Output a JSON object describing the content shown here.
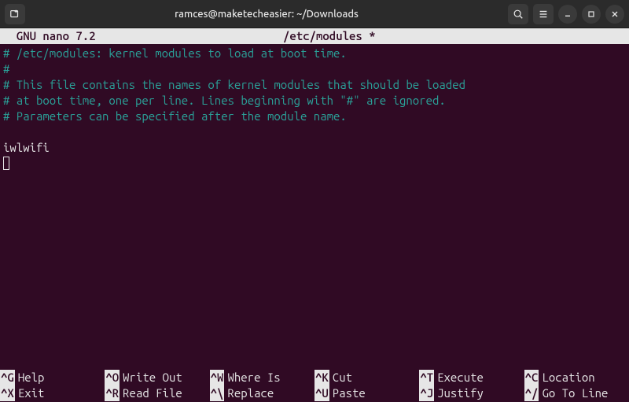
{
  "titlebar": {
    "title": "ramces@maketecheasier: ~/Downloads"
  },
  "nano": {
    "app": "  GNU nano 7.2",
    "file": "/etc/modules *"
  },
  "editor": {
    "l1": "# /etc/modules: kernel modules to load at boot time.",
    "l2": "#",
    "l3": "# This file contains the names of kernel modules that should be loaded",
    "l4": "# at boot time, one per line. Lines beginning with \"#\" are ignored.",
    "l5": "# Parameters can be specified after the module name.",
    "l6": "",
    "l7": "iwlwifi"
  },
  "shortcuts": {
    "row1": [
      {
        "k": "^G",
        "label": "Help"
      },
      {
        "k": "^O",
        "label": "Write Out"
      },
      {
        "k": "^W",
        "label": "Where Is"
      },
      {
        "k": "^K",
        "label": "Cut"
      },
      {
        "k": "^T",
        "label": "Execute"
      },
      {
        "k": "^C",
        "label": "Location"
      }
    ],
    "row2": [
      {
        "k": "^X",
        "label": "Exit"
      },
      {
        "k": "^R",
        "label": "Read File"
      },
      {
        "k": "^\\",
        "label": "Replace"
      },
      {
        "k": "^U",
        "label": "Paste"
      },
      {
        "k": "^J",
        "label": "Justify"
      },
      {
        "k": "^/",
        "label": "Go To Line"
      }
    ]
  }
}
